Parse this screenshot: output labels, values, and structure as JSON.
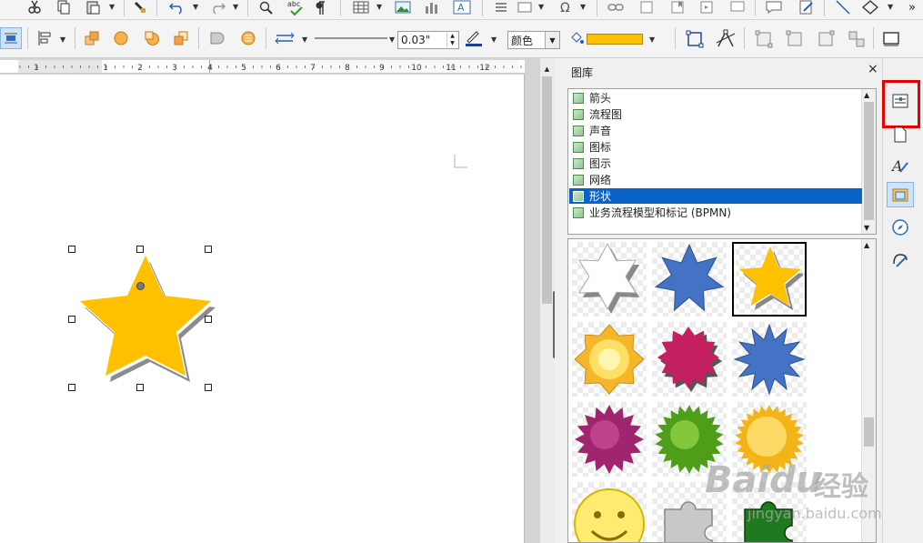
{
  "toolbar2": {
    "line_width_value": "0.03\"",
    "area_style_value": "颜色",
    "fill_color": "#ffc000"
  },
  "ruler": {
    "ticks": [
      {
        "label": "1"
      },
      {
        "label": "1"
      },
      {
        "label": "2"
      },
      {
        "label": "3"
      },
      {
        "label": "4"
      },
      {
        "label": "5"
      },
      {
        "label": "6"
      },
      {
        "label": "7"
      },
      {
        "label": "8"
      },
      {
        "label": "9"
      },
      {
        "label": "10"
      },
      {
        "label": "11"
      },
      {
        "label": "12"
      }
    ]
  },
  "gallery": {
    "title": "图库",
    "themes": [
      {
        "label": "箭头",
        "selected": false
      },
      {
        "label": "流程图",
        "selected": false
      },
      {
        "label": "声音",
        "selected": false
      },
      {
        "label": "图标",
        "selected": false
      },
      {
        "label": "图示",
        "selected": false
      },
      {
        "label": "网络",
        "selected": false
      },
      {
        "label": "形状",
        "selected": true
      },
      {
        "label": "业务流程模型和标记 (BPMN)",
        "selected": false
      }
    ],
    "items": [
      {
        "icon": "white-six-point-star-icon"
      },
      {
        "icon": "blue-seven-point-star-icon"
      },
      {
        "icon": "yellow-five-point-star-icon",
        "selected": true
      },
      {
        "icon": "yellow-sun-icon"
      },
      {
        "icon": "crimson-burst-icon"
      },
      {
        "icon": "blue-burst-icon"
      },
      {
        "icon": "purple-burst-icon"
      },
      {
        "icon": "green-burst-icon"
      },
      {
        "icon": "gold-burst-icon"
      },
      {
        "icon": "smiley-face-icon"
      },
      {
        "icon": "gray-puzzle-piece-icon"
      },
      {
        "icon": "green-puzzle-piece-icon"
      }
    ]
  },
  "sidebar_tabs": [
    {
      "icon": "properties-icon",
      "active": false
    },
    {
      "icon": "page-icon",
      "active": false
    },
    {
      "icon": "styles-icon",
      "active": false
    },
    {
      "icon": "gallery-icon",
      "active": true
    },
    {
      "icon": "navigator-icon",
      "active": false
    },
    {
      "icon": "style-inspector-icon",
      "active": false
    }
  ],
  "colors": {
    "selection_blue": "#0a64c8",
    "star_fill": "#ffc000",
    "highlight_red": "#e60000"
  },
  "watermark": {
    "brand": "Baidu",
    "brand_cn": "经验",
    "url": "jingyan.baidu.com"
  }
}
